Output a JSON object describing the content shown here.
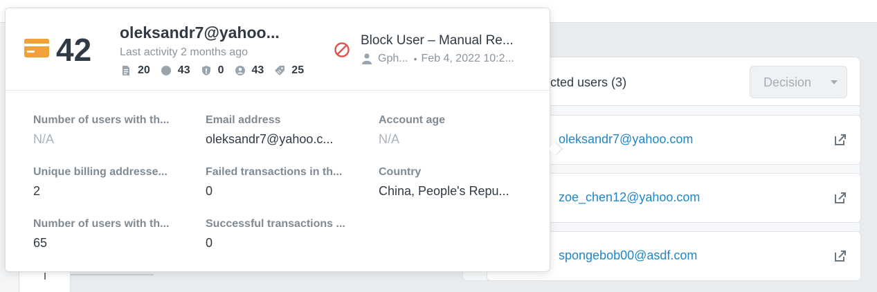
{
  "connected_users": {
    "title": "nected users (3)",
    "decision_label": "Decision",
    "users": [
      {
        "email": "oleksandr7@yahoo.com"
      },
      {
        "email": "zoe_chen12@yahoo.com"
      },
      {
        "email": "spongebob00@asdf.com"
      }
    ]
  },
  "popover": {
    "score": "42",
    "email_title": "oleksandr7@yahoo...",
    "last_activity": "Last activity 2 months ago",
    "stats": [
      {
        "icon": "document-icon",
        "value": "20"
      },
      {
        "icon": "circle-icon",
        "value": "43"
      },
      {
        "icon": "shield-icon",
        "value": "0"
      },
      {
        "icon": "user-circle-icon",
        "value": "43"
      },
      {
        "icon": "tag-icon",
        "value": "25"
      }
    ],
    "decision": {
      "title": "Block User – Manual Re...",
      "author": "Gph...",
      "separator": "•",
      "date": "Feb 4, 2022 10:2..."
    },
    "fields": [
      {
        "label": "Number of users with th...",
        "value": "N/A"
      },
      {
        "label": "Email address",
        "value": "oleksandr7@yahoo.c..."
      },
      {
        "label": "Account age",
        "value": "N/A"
      },
      {
        "label": "Unique billing addresse...",
        "value": "2"
      },
      {
        "label": "Failed transactions in th...",
        "value": "0"
      },
      {
        "label": "Country",
        "value": "China, People's Repu..."
      },
      {
        "label": "Number of users with th...",
        "value": "65"
      },
      {
        "label": "Successful transactions ...",
        "value": "0"
      }
    ]
  },
  "colors": {
    "accent_link": "#1f86c9",
    "score_card_icon": "#f0a13a",
    "block_icon": "#e0514f"
  }
}
